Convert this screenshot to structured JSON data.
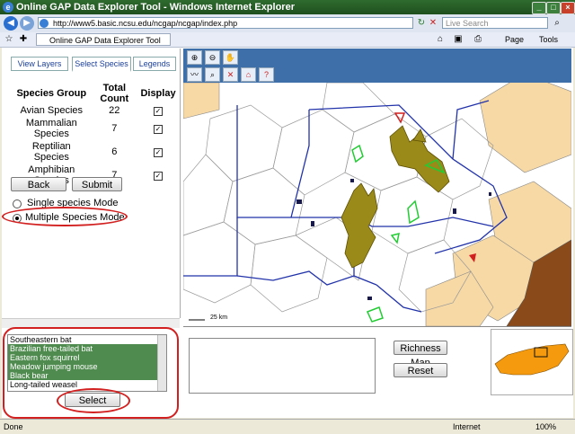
{
  "window": {
    "title": "Online GAP Data Explorer Tool - Windows Internet Explorer"
  },
  "address": {
    "url": "http://www5.basic.ncsu.edu/ncgap/ncgap/index.php",
    "search_placeholder": "Live Search"
  },
  "tab": {
    "label": "Online GAP Data Explorer Tool"
  },
  "commands": {
    "page": "Page",
    "tools": "Tools"
  },
  "left_tabs": [
    "View Layers",
    "Select Species",
    "Legends"
  ],
  "species_table": {
    "headers": {
      "group": "Species Group",
      "count": "Total Count",
      "display": "Display"
    },
    "rows": [
      {
        "group": "Avian Species",
        "count": "22",
        "checked": true
      },
      {
        "group": "Mammalian Species",
        "count": "7",
        "checked": true
      },
      {
        "group": "Reptilian Species",
        "count": "6",
        "checked": true
      },
      {
        "group": "Amphibian Species",
        "count": "7",
        "checked": true
      }
    ]
  },
  "buttons": {
    "back": "Back",
    "submit": "Submit",
    "select": "Select",
    "richness": "Richness Map",
    "reset": "Reset"
  },
  "modes": {
    "single": "Single species Mode",
    "multiple": "Multiple Species Mode",
    "selected": "multiple"
  },
  "species_list": [
    {
      "name": "Southeastern bat",
      "selected": false
    },
    {
      "name": "Brazilian free-tailed bat",
      "selected": true
    },
    {
      "name": "Eastern fox squirrel",
      "selected": true
    },
    {
      "name": "Meadow jumping mouse",
      "selected": true
    },
    {
      "name": "Black bear",
      "selected": true
    },
    {
      "name": "Long-tailed weasel",
      "selected": false
    }
  ],
  "map": {
    "scale_label": "25 km"
  },
  "status": {
    "left": "Done",
    "zone": "Internet",
    "zoom": "100%"
  },
  "colors": {
    "title_green": "#2f6b2f",
    "toolbar_blue": "#3f6fa8",
    "highlight_green": "#4f8a4f",
    "annotation_red": "#d21f1f",
    "map_tan": "#f7d9a6",
    "map_brown": "#8b4a1a",
    "minimap_orange": "#f59a0e"
  }
}
